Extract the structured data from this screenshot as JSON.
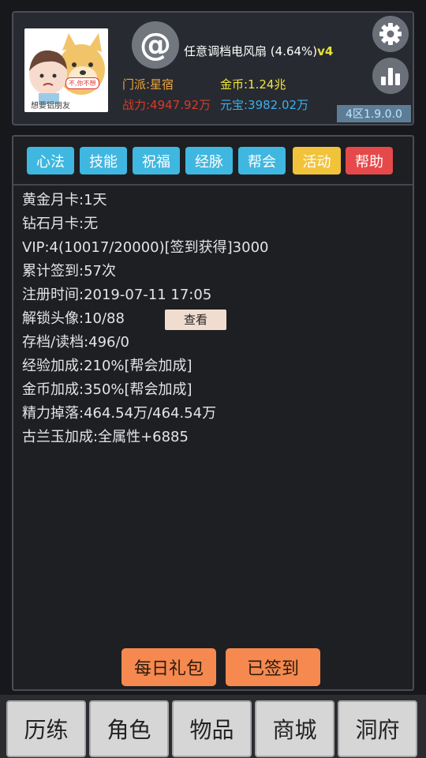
{
  "header": {
    "avatar_caption": "想要铝朋友",
    "avatar_speech": "不,你不想",
    "player_name": "任意调档电风扇",
    "player_pct": "(4.64%)",
    "player_vip": "v4",
    "sect": "门派:星宿",
    "gold": "金币:1.24兆",
    "power": "战力:4947.92万",
    "yuanbao": "元宝:3982.02万",
    "version": "4区1.9.0.0",
    "at_symbol": "@"
  },
  "tabs": [
    {
      "label": "心法",
      "color": "#3fb7e0"
    },
    {
      "label": "技能",
      "color": "#3fb7e0"
    },
    {
      "label": "祝福",
      "color": "#3fb7e0"
    },
    {
      "label": "经脉",
      "color": "#3fb7e0"
    },
    {
      "label": "帮会",
      "color": "#3fb7e0"
    },
    {
      "label": "活动",
      "color": "#f2c33a"
    },
    {
      "label": "帮助",
      "color": "#e6494a"
    }
  ],
  "info": {
    "lines": [
      "黄金月卡:1天",
      "钻石月卡:无",
      "VIP:4(10017/20000)[签到获得]3000",
      "累计签到:57次",
      "注册时间:2019-07-11 17:05",
      "解锁头像:10/88",
      "存档/读档:496/0",
      "经验加成:210%[帮会加成]",
      "金币加成:350%[帮会加成]",
      "精力掉落:464.54万/464.54万",
      "古兰玉加成:全属性+6885"
    ],
    "view_button": "查看"
  },
  "actions": {
    "daily_gift": "每日礼包",
    "signed_in": "已签到"
  },
  "bottom_nav": [
    {
      "label": "历练"
    },
    {
      "label": "角色"
    },
    {
      "label": "物品"
    },
    {
      "label": "商城"
    },
    {
      "label": "洞府"
    }
  ],
  "icons": {
    "settings": "gear-icon",
    "stats": "bar-chart-icon",
    "mention": "at-icon"
  }
}
